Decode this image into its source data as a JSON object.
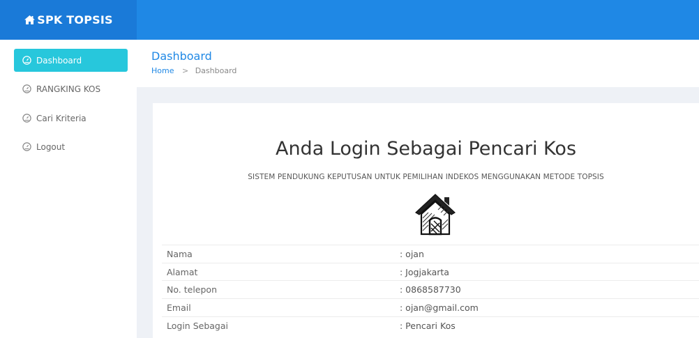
{
  "brand": {
    "title": "SPK TOPSIS",
    "icon": "home-icon"
  },
  "sidebar": {
    "items": [
      {
        "label": "Dashboard",
        "icon": "dashboard-icon",
        "active": true
      },
      {
        "label": "RANGKING KOS",
        "icon": "dashboard-icon",
        "active": false
      },
      {
        "label": "Cari Kriteria",
        "icon": "dashboard-icon",
        "active": false
      },
      {
        "label": "Logout",
        "icon": "dashboard-icon",
        "active": false
      }
    ]
  },
  "header": {
    "title": "Dashboard",
    "breadcrumb": {
      "home": "Home",
      "separator": ">",
      "current": "Dashboard"
    }
  },
  "main": {
    "title": "Anda Login Sebagai Pencari Kos",
    "subtitle": "SISTEM PENDUKUNG KEPUTUSAN UNTUK PEMILIHAN INDEKOS MENGGUNAKAN METODE TOPSIS",
    "illustration": "house-sketch-icon",
    "info_rows": [
      {
        "label": "Nama",
        "value": ": ojan"
      },
      {
        "label": "Alamat",
        "value": ": Jogjakarta"
      },
      {
        "label": "No. telepon",
        "value": ": 0868587730"
      },
      {
        "label": "Email",
        "value": ": ojan@gmail.com"
      },
      {
        "label": "Login Sebagai",
        "value": ": Pencari Kos"
      }
    ]
  },
  "colors": {
    "topbar": "#1f88e5",
    "brand": "#1a7ad8",
    "active_nav": "#27c7dc",
    "link": "#1f88e5",
    "background": "#eef1f6"
  }
}
